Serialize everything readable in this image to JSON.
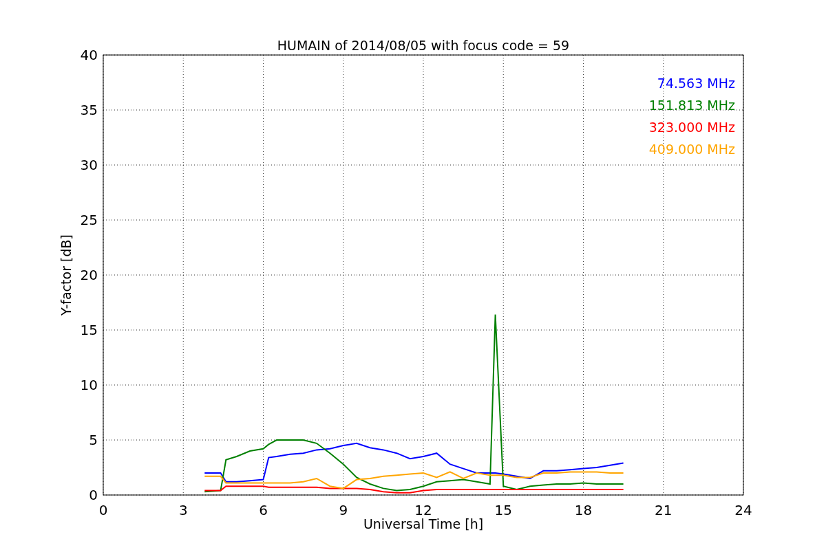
{
  "figure": {
    "chart_data": {
      "type": "line",
      "grid": true,
      "title": "HUMAIN of 2014/08/05 with focus code = 59",
      "xlabel": "Universal Time [h]",
      "ylabel": "Y-factor [dB]",
      "xlim": [
        0,
        24
      ],
      "ylim": [
        0,
        40
      ],
      "xticks": [
        0,
        3,
        6,
        9,
        12,
        15,
        18,
        21,
        24
      ],
      "yticks": [
        0,
        5,
        10,
        15,
        20,
        25,
        30,
        35,
        40
      ],
      "x": [
        3.8,
        4.4,
        4.6,
        5,
        5.5,
        6,
        6.2,
        6.5,
        7,
        7.5,
        8,
        8.5,
        9,
        9.5,
        10,
        10.5,
        11,
        11.5,
        12,
        12.5,
        13,
        13.5,
        14,
        14.5,
        14.7,
        15,
        15.5,
        16,
        16.5,
        17,
        17.5,
        18,
        18.5,
        19,
        19.5
      ],
      "series": [
        {
          "name": "74.563 MHz",
          "color": "#0000ff",
          "values": [
            2.0,
            2.0,
            1.2,
            1.2,
            1.3,
            1.4,
            3.4,
            3.5,
            3.7,
            3.8,
            4.1,
            4.2,
            4.5,
            4.7,
            4.3,
            4.1,
            3.8,
            3.3,
            3.5,
            3.8,
            2.8,
            2.4,
            2.0,
            2.0,
            2.0,
            1.9,
            1.7,
            1.5,
            2.2,
            2.2,
            2.3,
            2.4,
            2.5,
            2.7,
            2.9
          ]
        },
        {
          "name": "151.813 MHz",
          "color": "#008000",
          "values": [
            0.3,
            0.4,
            3.2,
            3.5,
            4.0,
            4.2,
            4.6,
            5.0,
            5.0,
            5.0,
            4.7,
            3.8,
            2.8,
            1.6,
            1.0,
            0.6,
            0.4,
            0.5,
            0.8,
            1.2,
            1.3,
            1.4,
            1.2,
            1.0,
            16.4,
            0.8,
            0.5,
            0.8,
            0.9,
            1.0,
            1.0,
            1.1,
            1.0,
            1.0,
            1.0
          ]
        },
        {
          "name": "323.000 MHz",
          "color": "#ff0000",
          "values": [
            0.4,
            0.4,
            0.8,
            0.8,
            0.8,
            0.8,
            0.7,
            0.7,
            0.7,
            0.7,
            0.7,
            0.6,
            0.6,
            0.6,
            0.5,
            0.3,
            0.2,
            0.2,
            0.4,
            0.5,
            0.5,
            0.5,
            0.5,
            0.5,
            0.5,
            0.5,
            0.5,
            0.5,
            0.5,
            0.5,
            0.5,
            0.5,
            0.5,
            0.5,
            0.5
          ]
        },
        {
          "name": "409.000 MHz",
          "color": "#ffa500",
          "values": [
            1.7,
            1.7,
            1.1,
            1.1,
            1.1,
            1.1,
            1.1,
            1.1,
            1.1,
            1.2,
            1.5,
            0.8,
            0.6,
            1.4,
            1.5,
            1.7,
            1.8,
            1.9,
            2.0,
            1.6,
            2.1,
            1.5,
            2.0,
            1.8,
            1.8,
            1.8,
            1.6,
            1.6,
            2.0,
            2.0,
            2.1,
            2.1,
            2.1,
            2.0,
            2.0
          ]
        }
      ]
    }
  }
}
